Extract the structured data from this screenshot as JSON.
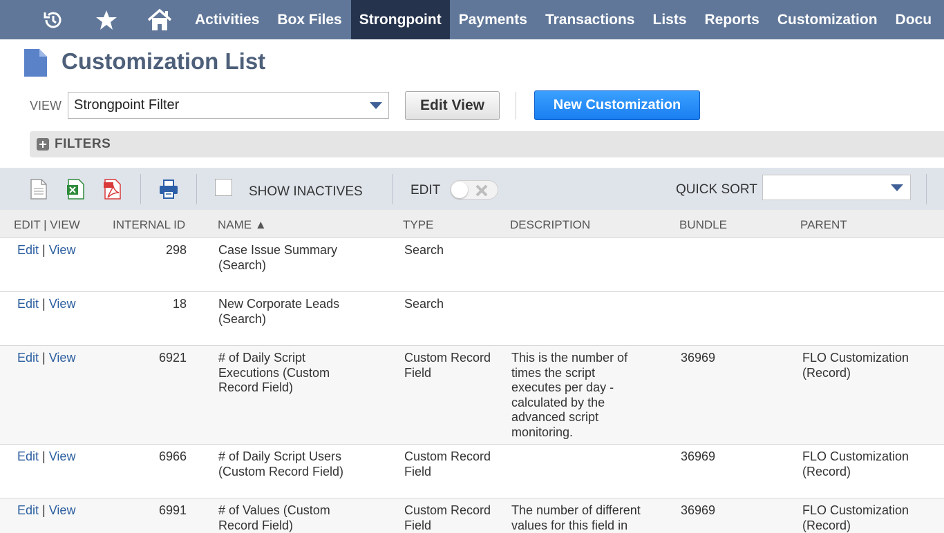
{
  "nav": {
    "icons": [
      "history-icon",
      "star-icon",
      "home-icon"
    ],
    "items": [
      "Activities",
      "Box Files",
      "Strongpoint",
      "Payments",
      "Transactions",
      "Lists",
      "Reports",
      "Customization",
      "Docu"
    ],
    "active_index": 2
  },
  "page": {
    "title": "Customization List"
  },
  "view": {
    "label": "VIEW",
    "selected": "Strongpoint Filter",
    "edit_view_label": "Edit View",
    "new_label": "New Customization"
  },
  "filters": {
    "label": "FILTERS"
  },
  "toolbar": {
    "show_inactives_label": "SHOW INACTIVES",
    "edit_label": "EDIT",
    "quick_sort_label": "QUICK SORT",
    "quick_sort_value": ""
  },
  "table": {
    "headers": {
      "edit_view": "EDIT | VIEW",
      "internal_id": "INTERNAL ID",
      "name": "NAME ▲",
      "type": "TYPE",
      "description": "DESCRIPTION",
      "bundle": "BUNDLE",
      "parent": "PARENT"
    },
    "edit_link": "Edit",
    "view_link": "View",
    "rows": [
      {
        "id": "298",
        "name": "Case Issue Summary (Search)",
        "type": "Search",
        "description": "",
        "bundle": "",
        "parent": ""
      },
      {
        "id": "18",
        "name": "New Corporate Leads (Search)",
        "type": "Search",
        "description": "",
        "bundle": "",
        "parent": ""
      },
      {
        "id": "6921",
        "name": "# of Daily Script Executions (Custom Record Field)",
        "type": "Custom Record Field",
        "description": "This is the number of times the script executes per day - calculated by the advanced script monitoring.",
        "bundle": "36969",
        "parent": "FLO Customization (Record)"
      },
      {
        "id": "6966",
        "name": "# of Daily Script Users (Custom Record Field)",
        "type": "Custom Record Field",
        "description": "",
        "bundle": "36969",
        "parent": "FLO Customization (Record)"
      },
      {
        "id": "6991",
        "name": "# of Values (Custom Record Field)",
        "type": "Custom Record Field",
        "description": "The number of different values for this field in",
        "bundle": "36969",
        "parent": "FLO Customization (Record)"
      }
    ]
  },
  "colors": {
    "nav_bg": "#607799",
    "nav_active": "#25334d",
    "title": "#4d5f79",
    "primary_button": "#1a7ef0",
    "link": "#2a5d9f"
  }
}
